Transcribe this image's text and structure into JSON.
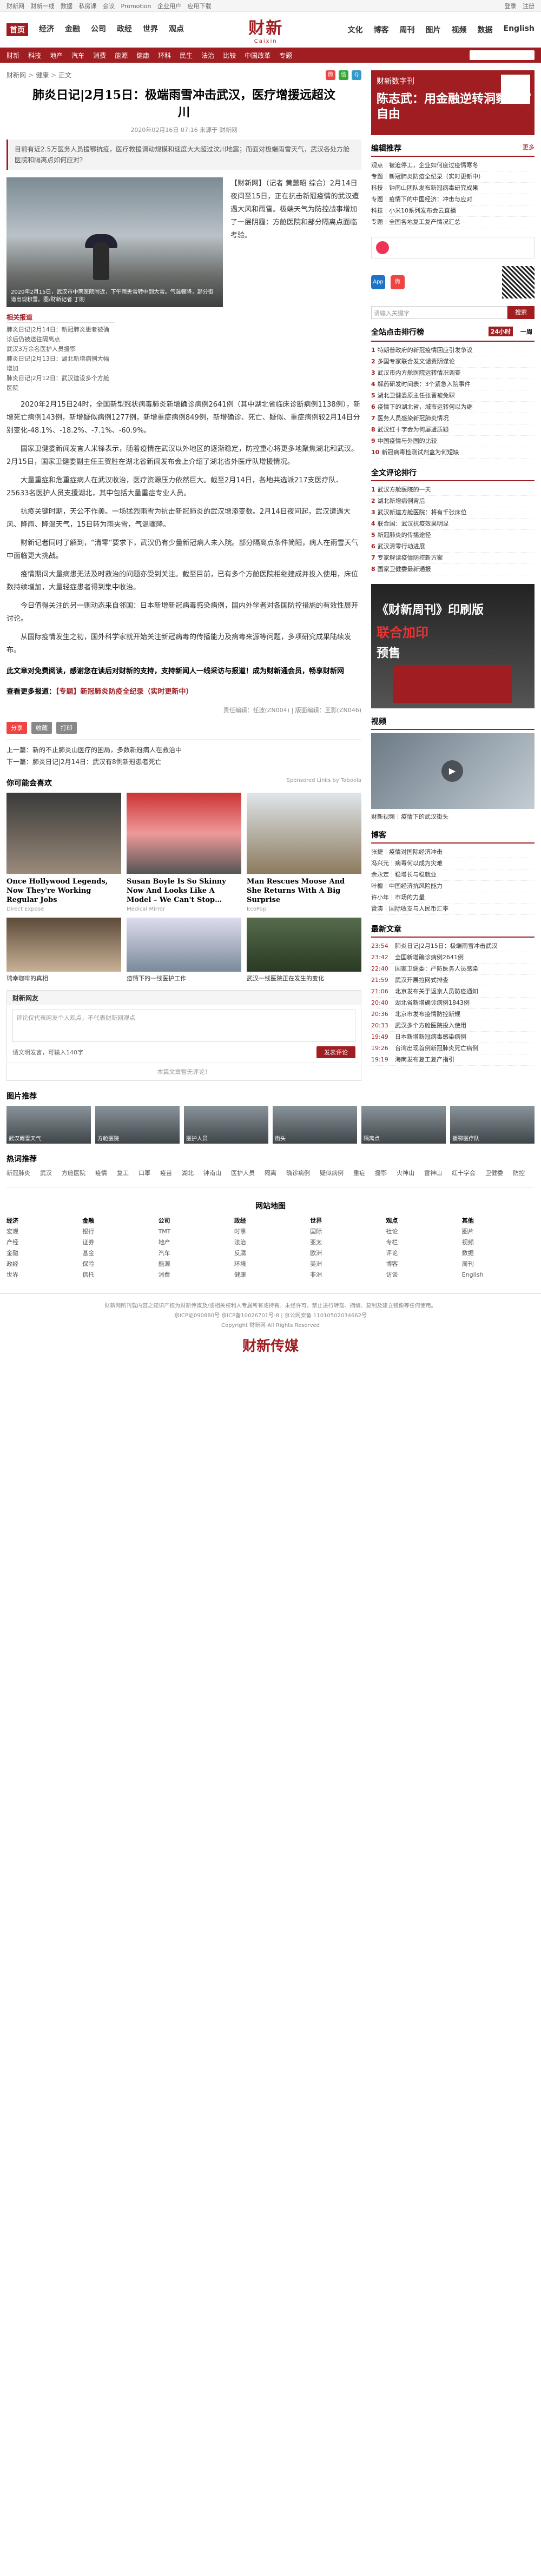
{
  "topbar": {
    "links": [
      "财新网",
      "财新一线",
      "数据",
      "私房课",
      "会议",
      "Promotion",
      "企业用户",
      "应用下载"
    ],
    "user": [
      "登录",
      "注册"
    ]
  },
  "header": {
    "logo_cn": "财新",
    "logo_en": "Caixin",
    "nav_left": [
      "首页",
      "经济",
      "金融",
      "公司",
      "政经",
      "世界",
      "观点"
    ],
    "nav_right": [
      "文化",
      "博客",
      "周刊",
      "图片",
      "视频",
      "数据",
      "English"
    ]
  },
  "subnav": [
    "财新",
    "科技",
    "地产",
    "汽车",
    "消费",
    "能源",
    "健康",
    "环科",
    "民生",
    "法治",
    "比较",
    "中国改革",
    "专题"
  ],
  "breadcrumb": [
    "财新网",
    "健康",
    "正文"
  ],
  "article": {
    "title": "肺炎日记|2月15日：极端雨雪冲击武汉，医疗增援远超汶川",
    "meta": "2020年02月16日 07:16 来源于 财新网",
    "summary": "目前有近2.5万医务人员援鄂抗疫，医疗救援调动规模和速度大大超过汶川地震；而面对极端雨雪天气，武汉各处方舱医院和隔离点如何应对？",
    "photo_caption": "2020年2月15日，武汉市中南医院附近，下午雨夹雪转中到大雪。气温骤降，部分街道出现积雪。图/财新记者 丁刚",
    "lead": "【财新网】（记者 黄蕙昭 综合）2月14日夜间至15日，正在抗击新冠疫情的武汉遭遇大风和雨雪。极端天气为防控战事增加了一层阴霾：方舱医院和部分隔离点面临考验。",
    "lead_src": "（记者 黄蕙昭 综合）",
    "related_title": "相关报道",
    "related": [
      "肺炎日记|2月14日：新冠肺炎患者被确诊后仍被送往隔离点",
      "武汉3万余名医护人员援鄂",
      "肺炎日记|2月13日：湖北新增病例大幅增加",
      "肺炎日记|2月12日：武汉建设多个方舱医院"
    ],
    "paragraphs": [
      "2020年2月15日24时，全国新型冠状病毒肺炎新增确诊病例2641例（其中湖北省临床诊断病例1138例），新增死亡病例143例，新增疑似病例1277例，新增重症病例849例，新增确诊、死亡、疑似、重症病例较2月14日分别变化-48.1%、-18.2%、-7.1%、-60.9%。",
      "国家卫健委新闻发言人米锋表示，随着疫情在武汉以外地区的逐渐稳定，防控重心将更多地聚焦湖北和武汉。2月15日，国家卫健委副主任王贺胜在湖北省新闻发布会上介绍了湖北省外医疗队增援情况。",
      "大量重症和危重症病人在武汉收治，医疗资源压力依然巨大。截至2月14日，各地共选派217支医疗队、25633名医护人员支援湖北，其中包括大量重症专业人员。",
      "抗疫关键时期，天公不作美。一场猛烈雨雪为抗击新冠肺炎的武汉增添变数。2月14日夜间起，武汉遭遇大风、降雨、降温天气，15日转为雨夹雪，气温骤降。",
      "财新记者同时了解到，“清零”要求下，武汉仍有少量新冠病人未入院。部分隔离点条件简陋，病人在雨雪天气中面临更大挑战。",
      "疫情期间大量病患无法及时救治的问题亦受到关注。截至目前，已有多个方舱医院相继建成并投入使用，床位数持续增加，大量轻症患者得到集中收治。",
      "今日值得关注的另一则动态来自邻国：日本新增新冠病毒感染病例，国内外学者对各国防控措施的有效性展开讨论。",
      "从国际疫情发生之初，国外科学家就开始关注新冠病毒的传播能力及病毒来源等问题，多项研究成果陆续发布。"
    ],
    "note1": "此文章对免费阅读，感谢您在读后对财新的支持，支持新闻人一线采访与报道！成为财新通会员，畅享财新网",
    "note1_red": "成为财新通会员",
    "note2_label": "查看更多报道：",
    "note2_link": "【专题】新冠肺炎防疫全纪录（实时更新中）",
    "editor": "责任编辑：任波(ZN004) | 版面编辑：王影(ZN046)",
    "share_buttons": [
      "分享",
      "收藏",
      "打印"
    ],
    "prev": "上一篇：新的不止肺炎山医疗的困局，多数新冠病人在救治中",
    "next": "下一篇：肺炎日记|2月14日：武汉有8例新冠患者死亡"
  },
  "recommend": {
    "title": "你可能会喜欢",
    "sponsor": "Sponsored Links by Taboola",
    "ads": [
      {
        "title": "Once Hollywood Legends, Now They're Working Regular Jobs",
        "src": "Direct Expose"
      },
      {
        "title": "Susan Boyle Is So Skinny Now And Looks Like A Model – We Can't Stop…",
        "src": "Medical Mirror"
      },
      {
        "title": "Man Rescues Moose And She Returns With A Big Surprise",
        "src": "EcoPop"
      }
    ],
    "ads2": [
      "瑞幸咖啡的真相",
      "疫情下的一线医护工作",
      "武汉一线医院正在发生的变化"
    ]
  },
  "comment": {
    "title": "财新网友",
    "placeholder": "评论仅代表网友个人观点，不代表财新网观点",
    "hint": "请文明发言，可输入140字",
    "send": "发表评论",
    "empty": "本篇文章暂无评论！"
  },
  "sidebar": {
    "banner_top": "财新数字刊",
    "banner_main": "陈志武：用金融逆转洞察财富自由",
    "editor_pick_title": "编辑推荐",
    "editor_pick_more": "更多",
    "editor_pick": [
      "观点｜被迫停工，企业如何度过疫情寒冬",
      "专题｜新冠肺炎防疫全纪录（实时更新中）",
      "科技｜钟南山团队发布新冠病毒研究成果",
      "专题｜疫情下的中国经济：冲击与应对",
      "科技｜小米10系列发布会云直播",
      "专题｜全国各地复工复产情况汇总"
    ],
    "search_placeholder": "请输入关键字",
    "search_btn": "搜索",
    "hot_title": "全站点击排行榜",
    "hot_tabs": [
      "24小时",
      "一周"
    ],
    "hot": [
      "特朗普政府的新冠疫情回应引发争议",
      "多国专家联合发文谴责阴谋论",
      "武汉市内方舱医院运转情况调查",
      "解药研发时间表：3个紧急入院事件",
      "湖北卫健委原主任张晋被免职",
      "疫情下的湖北省，城市运转何以为继",
      "医务人员感染新冠肺炎情况",
      "武汉红十字会为何屡遭质疑",
      "中国疫情与外国的比较",
      "新冠病毒检测试剂盒为何短缺"
    ],
    "comment_rank_title": "全文评论排行",
    "comment_rank": [
      "武汉方舱医院的一天",
      "湖北新增病例背后",
      "武汉新建方舱医院：将有千张床位",
      "联合国：武汉抗疫效果明显",
      "新冠肺炎的传播途径",
      "武汉清零行动进展",
      "专家解读疫情防控新方案",
      "国家卫健委最新通报"
    ],
    "magazine": [
      "《财新周刊》印刷版",
      "联合加印",
      "预售"
    ],
    "video_title": "视频",
    "video_caption": "财新视频｜疫情下的武汉街头",
    "blog_title": "博客",
    "blog": [
      "张捷｜疫情对国际经济冲击",
      "冯兴元｜病毒何以成为灾难",
      "余永定｜稳增长与稳就业",
      "叶檀｜中国经济抗风险能力",
      "许小年｜市场的力量",
      "管涛｜国际收支与人民币汇率"
    ],
    "latest_title": "最新文章",
    "latest": [
      {
        "t": "23:54",
        "s": "肺炎日记|2月15日：极端雨雪冲击武汉"
      },
      {
        "t": "23:42",
        "s": "全国新增确诊病例2641例"
      },
      {
        "t": "22:40",
        "s": "国家卫健委：严防医务人员感染"
      },
      {
        "t": "21:59",
        "s": "武汉开展拉网式排查"
      },
      {
        "t": "21:06",
        "s": "北京发布关于返京人员防疫通知"
      },
      {
        "t": "20:40",
        "s": "湖北省新增确诊病例1843例"
      },
      {
        "t": "20:36",
        "s": "北京市发布疫情防控新规"
      },
      {
        "t": "20:33",
        "s": "武汉多个方舱医院投入使用"
      },
      {
        "t": "19:49",
        "s": "日本新增新冠病毒感染病例"
      },
      {
        "t": "19:26",
        "s": "台湾出现首例新冠肺炎死亡病例"
      },
      {
        "t": "19:19",
        "s": "海南发布复工复产指引"
      }
    ]
  },
  "gallery_title": "图片推荐",
  "galleries": [
    "武汉雨雪天气",
    "方舱医院",
    "医护人员",
    "街头",
    "隔离点",
    "援鄂医疗队"
  ],
  "hot_words_title": "热词推荐",
  "hot_words": [
    "新冠肺炎",
    "武汉",
    "方舱医院",
    "疫情",
    "复工",
    "口罩",
    "疫苗",
    "湖北",
    "钟南山",
    "医护人员",
    "隔离",
    "确诊病例",
    "疑似病例",
    "重症",
    "援鄂",
    "火神山",
    "雷神山",
    "红十字会",
    "卫健委",
    "防控"
  ],
  "sitemap": {
    "title": "网站地图",
    "cols": [
      {
        "h": "经济",
        "items": [
          "宏观",
          "产经",
          "金融",
          "政经",
          "世界"
        ]
      },
      {
        "h": "金融",
        "items": [
          "银行",
          "证券",
          "基金",
          "保险",
          "信托"
        ]
      },
      {
        "h": "公司",
        "items": [
          "TMT",
          "地产",
          "汽车",
          "能源",
          "消费"
        ]
      },
      {
        "h": "政经",
        "items": [
          "时事",
          "法治",
          "反腐",
          "环境",
          "健康"
        ]
      },
      {
        "h": "世界",
        "items": [
          "国际",
          "亚太",
          "欧洲",
          "美洲",
          "非洲"
        ]
      },
      {
        "h": "观点",
        "items": [
          "社论",
          "专栏",
          "评论",
          "博客",
          "访谈"
        ]
      },
      {
        "h": "其他",
        "items": [
          "图片",
          "视频",
          "数据",
          "周刊",
          "English"
        ]
      }
    ]
  },
  "footer": {
    "lines": [
      "财新网所刊载内容之知识产权为财新传媒及/或相关权利人专属所有或持有。未经许可，禁止进行转载、摘编、复制及建立镜像等任何使用。",
      "京ICP证090880号 京ICP备10026701号-8 | 京公网安备 11010502034662号",
      "Copyright 财新网 All Rights Reserved"
    ],
    "logo": "财新传媒"
  }
}
